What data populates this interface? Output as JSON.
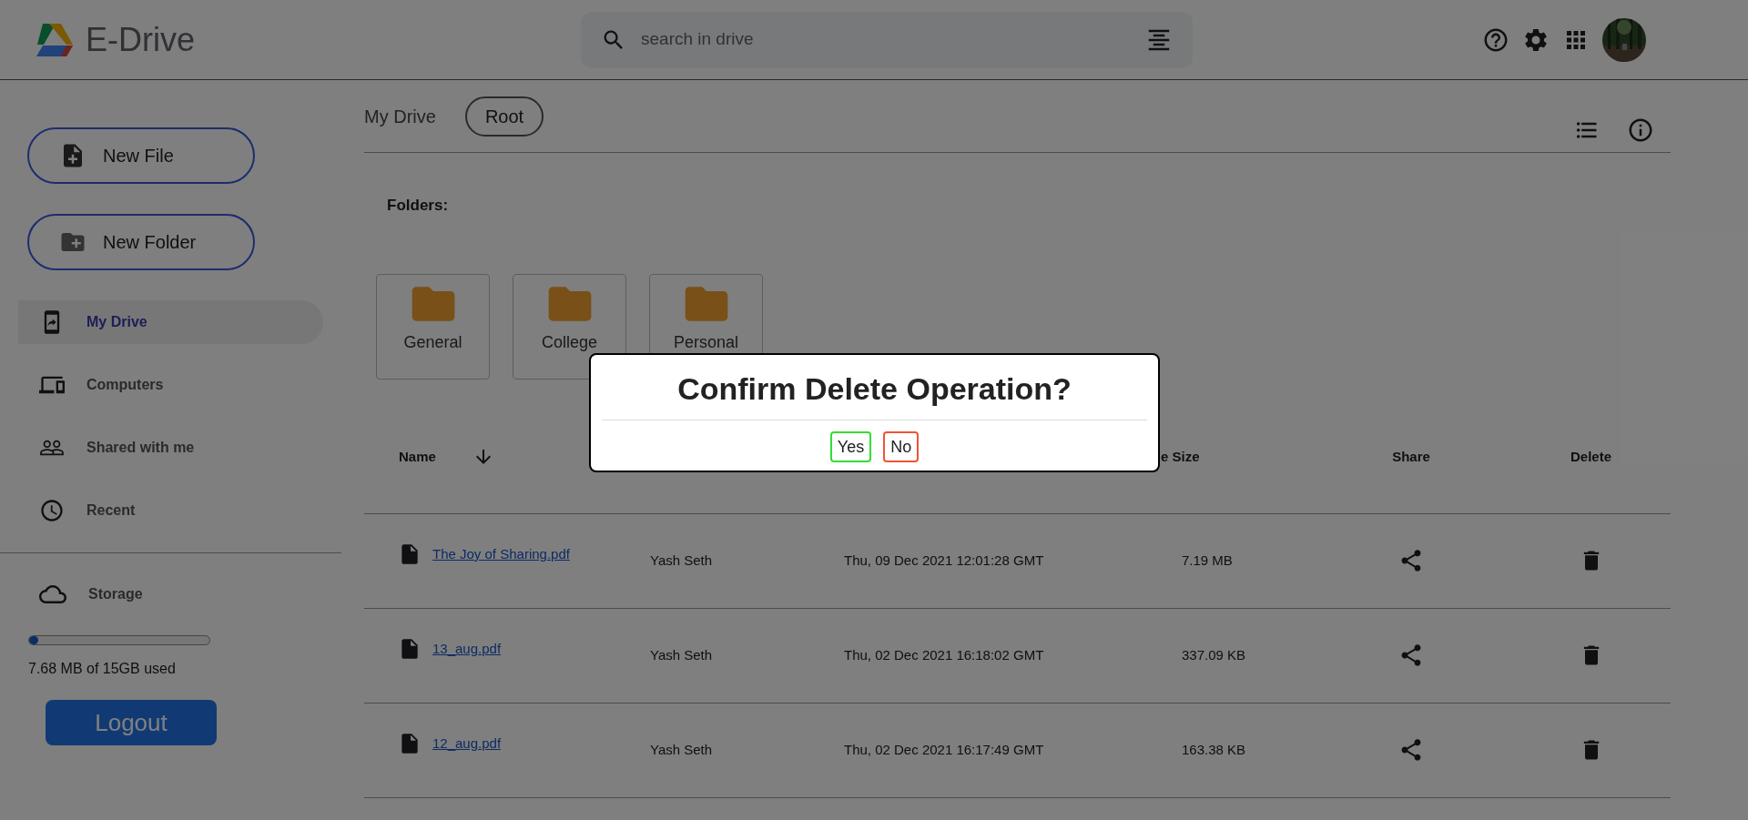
{
  "app": {
    "title": "E-Drive"
  },
  "search": {
    "placeholder": "search in drive"
  },
  "sidebar": {
    "buttons": [
      {
        "kind": "file",
        "label": "New File"
      },
      {
        "kind": "folder",
        "label": "New Folder"
      }
    ],
    "items": [
      {
        "kind": "drive",
        "label": "My Drive",
        "selected": true
      },
      {
        "kind": "computers",
        "label": "Computers",
        "selected": false
      },
      {
        "kind": "shared",
        "label": "Shared with me",
        "selected": false
      },
      {
        "kind": "recent",
        "label": "Recent",
        "selected": false
      }
    ],
    "storage": {
      "label": "Storage",
      "level": 0.05,
      "usage": "7.68 MB of 15GB used"
    },
    "logout": "Logout"
  },
  "breadcrumb": [
    {
      "kind": "text",
      "label": "My Drive"
    },
    {
      "kind": "pill",
      "label": "Root"
    }
  ],
  "folders": {
    "heading": "Folders:",
    "items": [
      "General",
      "College",
      "Personal"
    ]
  },
  "table": {
    "columns": [
      {
        "kind": "name",
        "label": "Name"
      },
      {
        "kind": "size",
        "label": "e Size"
      },
      {
        "kind": "share",
        "label": "Share"
      },
      {
        "kind": "delete",
        "label": "Delete"
      }
    ],
    "rows": [
      {
        "name": "The Joy of Sharing.pdf",
        "owner": "Yash Seth",
        "modified": "Thu, 09 Dec 2021 12:01:28 GMT",
        "size": "7.19 MB"
      },
      {
        "name": "13_aug.pdf",
        "owner": "Yash Seth",
        "modified": "Thu, 02 Dec 2021 16:18:02 GMT",
        "size": "337.09 KB"
      },
      {
        "name": "12_aug.pdf",
        "owner": "Yash Seth",
        "modified": "Thu, 02 Dec 2021 16:17:49 GMT",
        "size": "163.38 KB"
      }
    ]
  },
  "dialog": {
    "title": "Confirm Delete Operation?",
    "buttons": [
      {
        "label": "Yes",
        "color": "#33dd33"
      },
      {
        "label": "No",
        "color": "#ee5533"
      }
    ]
  }
}
